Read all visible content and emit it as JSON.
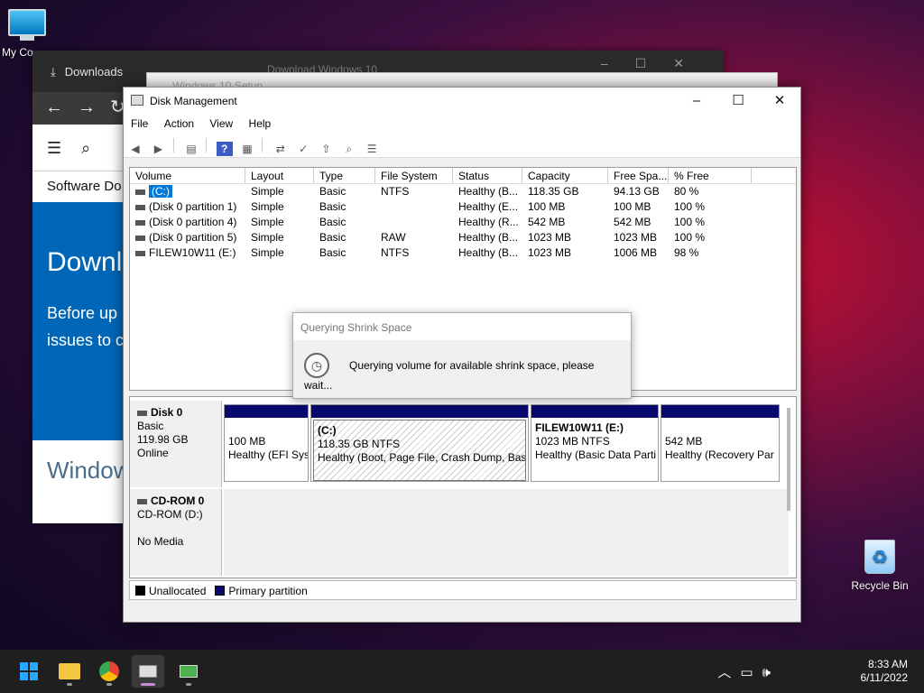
{
  "desktop": {
    "my_computer": "My Co",
    "recycle_bin": "Recycle Bin"
  },
  "edge": {
    "tab_label": "Downloads",
    "menu_title": "Software Do",
    "hero_title": "Downl",
    "hero_line1": "Before up",
    "hero_line2": "issues to c",
    "footer": "Window"
  },
  "setup": {
    "title": "Windows 10 Setup"
  },
  "third_window": {
    "title": "Download Windows 10"
  },
  "disk_management": {
    "title": "Disk Management",
    "menu": [
      "File",
      "Action",
      "View",
      "Help"
    ],
    "columns": [
      "Volume",
      "Layout",
      "Type",
      "File System",
      "Status",
      "Capacity",
      "Free Spa...",
      "% Free"
    ],
    "volumes": [
      {
        "volume": "(C:)",
        "layout": "Simple",
        "type": "Basic",
        "fs": "NTFS",
        "status": "Healthy (B...",
        "capacity": "118.35 GB",
        "free": "94.13 GB",
        "pct": "80 %"
      },
      {
        "volume": "(Disk 0 partition 1)",
        "layout": "Simple",
        "type": "Basic",
        "fs": "",
        "status": "Healthy (E...",
        "capacity": "100 MB",
        "free": "100 MB",
        "pct": "100 %"
      },
      {
        "volume": "(Disk 0 partition 4)",
        "layout": "Simple",
        "type": "Basic",
        "fs": "",
        "status": "Healthy (R...",
        "capacity": "542 MB",
        "free": "542 MB",
        "pct": "100 %"
      },
      {
        "volume": "(Disk 0 partition 5)",
        "layout": "Simple",
        "type": "Basic",
        "fs": "RAW",
        "status": "Healthy (B...",
        "capacity": "1023 MB",
        "free": "1023 MB",
        "pct": "100 %"
      },
      {
        "volume": "FILEW10W11 (E:)",
        "layout": "Simple",
        "type": "Basic",
        "fs": "NTFS",
        "status": "Healthy (B...",
        "capacity": "1023 MB",
        "free": "1006 MB",
        "pct": "98 %"
      }
    ],
    "disk0": {
      "name": "Disk 0",
      "type": "Basic",
      "size": "119.98 GB",
      "state": "Online",
      "partitions": [
        {
          "line1": "",
          "line2": "100 MB",
          "line3": "Healthy (EFI Sys"
        },
        {
          "line1": "(C:)",
          "line2": "118.35 GB NTFS",
          "line3": "Healthy (Boot, Page File, Crash Dump, Basic"
        },
        {
          "line1": "FILEW10W11  (E:)",
          "line2": "1023 MB NTFS",
          "line3": "Healthy (Basic Data Parti"
        },
        {
          "line1": "",
          "line2": "542 MB",
          "line3": "Healthy (Recovery Par"
        }
      ]
    },
    "cdrom": {
      "name": "CD-ROM 0",
      "drive": "CD-ROM (D:)",
      "media": "No Media"
    },
    "legend": {
      "unallocated": "Unallocated",
      "primary": "Primary partition",
      "unallocated_color": "#000000",
      "primary_color": "#08086e"
    }
  },
  "dialog": {
    "title": "Querying Shrink Space",
    "message": "Querying volume for available shrink space, please wait..."
  },
  "taskbar": {
    "time": "8:33 AM",
    "date": "6/11/2022"
  }
}
